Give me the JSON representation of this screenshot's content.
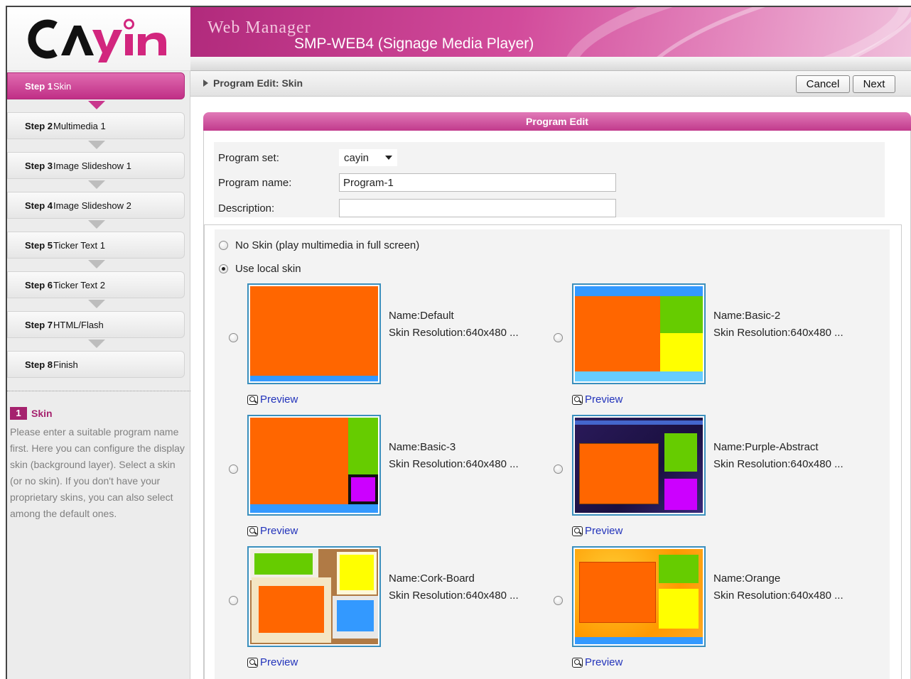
{
  "header": {
    "logo": "CAYIN",
    "title": "Web Manager",
    "subtitle": "SMP-WEB4 (Signage Media Player)"
  },
  "steps": [
    {
      "num": "Step 1",
      "name": "Skin",
      "active": true
    },
    {
      "num": "Step 2",
      "name": "Multimedia 1"
    },
    {
      "num": "Step 3",
      "name": "Image Slideshow 1"
    },
    {
      "num": "Step 4",
      "name": "Image Slideshow 2"
    },
    {
      "num": "Step 5",
      "name": "Ticker Text 1"
    },
    {
      "num": "Step 6",
      "name": "Ticker Text 2"
    },
    {
      "num": "Step 7",
      "name": "HTML/Flash"
    },
    {
      "num": "Step 8",
      "name": "Finish"
    }
  ],
  "help": {
    "badge": "1",
    "title": "Skin",
    "text": "Please enter a suitable program name first. Here you can configure the display skin (background layer). Select a skin (or no skin). If you don't have your proprietary skins, you can also select among the default ones."
  },
  "toolbar": {
    "breadcrumb": "Program Edit: Skin",
    "cancel_label": "Cancel",
    "next_label": "Next"
  },
  "panel": {
    "title": "Program Edit",
    "program_set_label": "Program set:",
    "program_set_value": "cayin",
    "program_name_label": "Program name:",
    "program_name_value": "Program-1",
    "description_label": "Description:",
    "description_value": ""
  },
  "skin_options": {
    "no_skin_label": "No Skin (play multimedia in full screen)",
    "local_skin_label": "Use local skin",
    "selected": "local"
  },
  "skins": [
    {
      "name": "Name:Default",
      "resolution": "Skin Resolution:640x480 ...",
      "preview": "Preview"
    },
    {
      "name": "Name:Basic-2",
      "resolution": "Skin Resolution:640x480 ...",
      "preview": "Preview"
    },
    {
      "name": "Name:Basic-3",
      "resolution": "Skin Resolution:640x480 ...",
      "preview": "Preview"
    },
    {
      "name": "Name:Purple-Abstract",
      "resolution": "Skin Resolution:640x480 ...",
      "preview": "Preview"
    },
    {
      "name": "Name:Cork-Board",
      "resolution": "Skin Resolution:640x480 ...",
      "preview": "Preview"
    },
    {
      "name": "Name:Orange",
      "resolution": "Skin Resolution:640x480 ...",
      "preview": "Preview"
    }
  ],
  "colors": {
    "accent": "#c13a8c",
    "zone_orange": "#ff6600",
    "zone_green": "#66cc00",
    "zone_yellow": "#ffff00",
    "zone_blue": "#3399ff",
    "zone_purple": "#cc00ff"
  }
}
